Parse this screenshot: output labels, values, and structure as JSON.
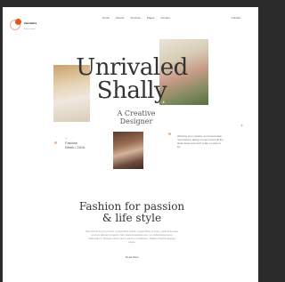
{
  "brand": {
    "name": "Zanzaldra",
    "tagline": "fashion studio",
    "accent": "#e8541e"
  },
  "nav": {
    "items": [
      "Home",
      "Abouts",
      "Services",
      "Pages",
      "Contact"
    ],
    "cta": "Contact"
  },
  "hero": {
    "title_line1": "Unrivaled",
    "title_line2": "Shally",
    "subtitle_line1": "A Creative",
    "subtitle_line2": "Designer"
  },
  "left_note": {
    "plus": "+",
    "line1": "Fashion",
    "line2": "Week / 2016"
  },
  "right_note": {
    "text": "Working as a creative and passionate new fashion design project and pull the ideal dress and we'll make it ready to be."
  },
  "section": {
    "title_line1": "Fashion for passion",
    "title_line2": "& life style",
    "body": "Nam viverra at nisl a cursus. Suspendisse potenti. Suspendisse ut turpis, mattis accumsan sit amet, aliquam ut sapien. Nam placerat egestas ante, nec pellentesque lacus malesuada id. Quisque rutrum luctus mauris eu vestibulum. Nullam pharetra magna a mauris.",
    "cta": "Read More"
  }
}
